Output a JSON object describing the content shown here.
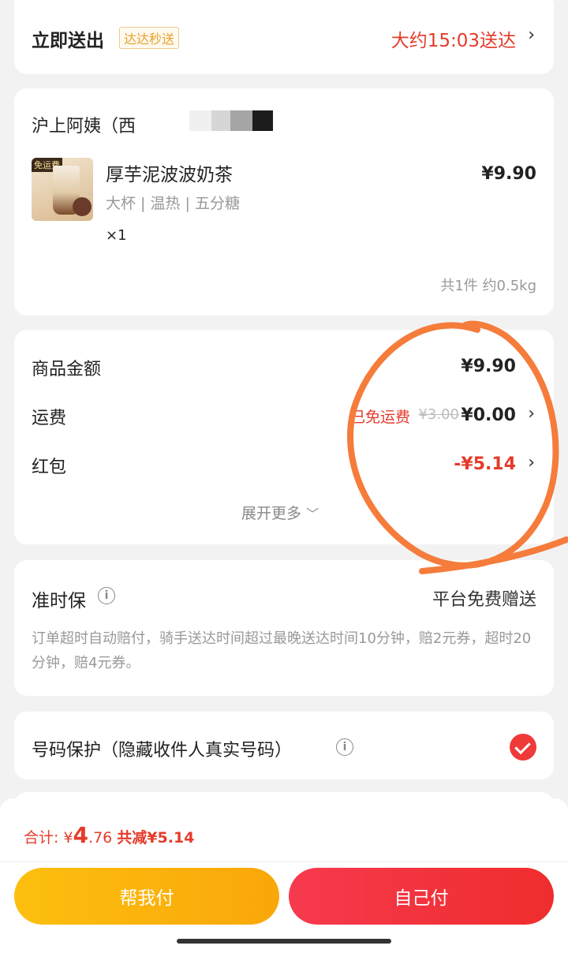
{
  "delivery": {
    "title": "立即送出",
    "badge": "达达秒送",
    "eta": "大约15:03送达"
  },
  "store": {
    "name": "沪上阿姨（西"
  },
  "item": {
    "tag": "免运费",
    "name": "厚芋泥波波奶茶",
    "spec": "大杯 | 温热 | 五分糖",
    "qty": "×1",
    "price": "¥9.90"
  },
  "items_summary": "共1件 约0.5kg",
  "fees": {
    "goods_label": "商品金额",
    "goods_value": "¥9.90",
    "delivery_label": "运费",
    "delivery_tag": "已免运费",
    "delivery_original": "¥3.00",
    "delivery_value": "¥0.00",
    "redpacket_label": "红包",
    "redpacket_value": "-¥5.14",
    "more": "展开更多"
  },
  "guarantee": {
    "title": "准时保",
    "right": "平台免费赠送",
    "desc": "订单超时自动赔付，骑手送达时间超过最晚送达时间10分钟，赔2元券，超时20分钟，赔4元券。"
  },
  "privacy": {
    "title": "号码保护（隐藏收件人真实号码）",
    "checked": true
  },
  "total": {
    "label": "合计:",
    "currency": "¥",
    "int": "4",
    "dec": ".76",
    "discount": "共减¥5.14"
  },
  "buttons": {
    "help_pay": "帮我付",
    "self_pay": "自己付"
  },
  "colors": {
    "accent_red": "#e53b2a",
    "help_yellow": "#fdbf0f",
    "self_red": "#f63a4e",
    "highlight_orange": "#f57c3b"
  }
}
